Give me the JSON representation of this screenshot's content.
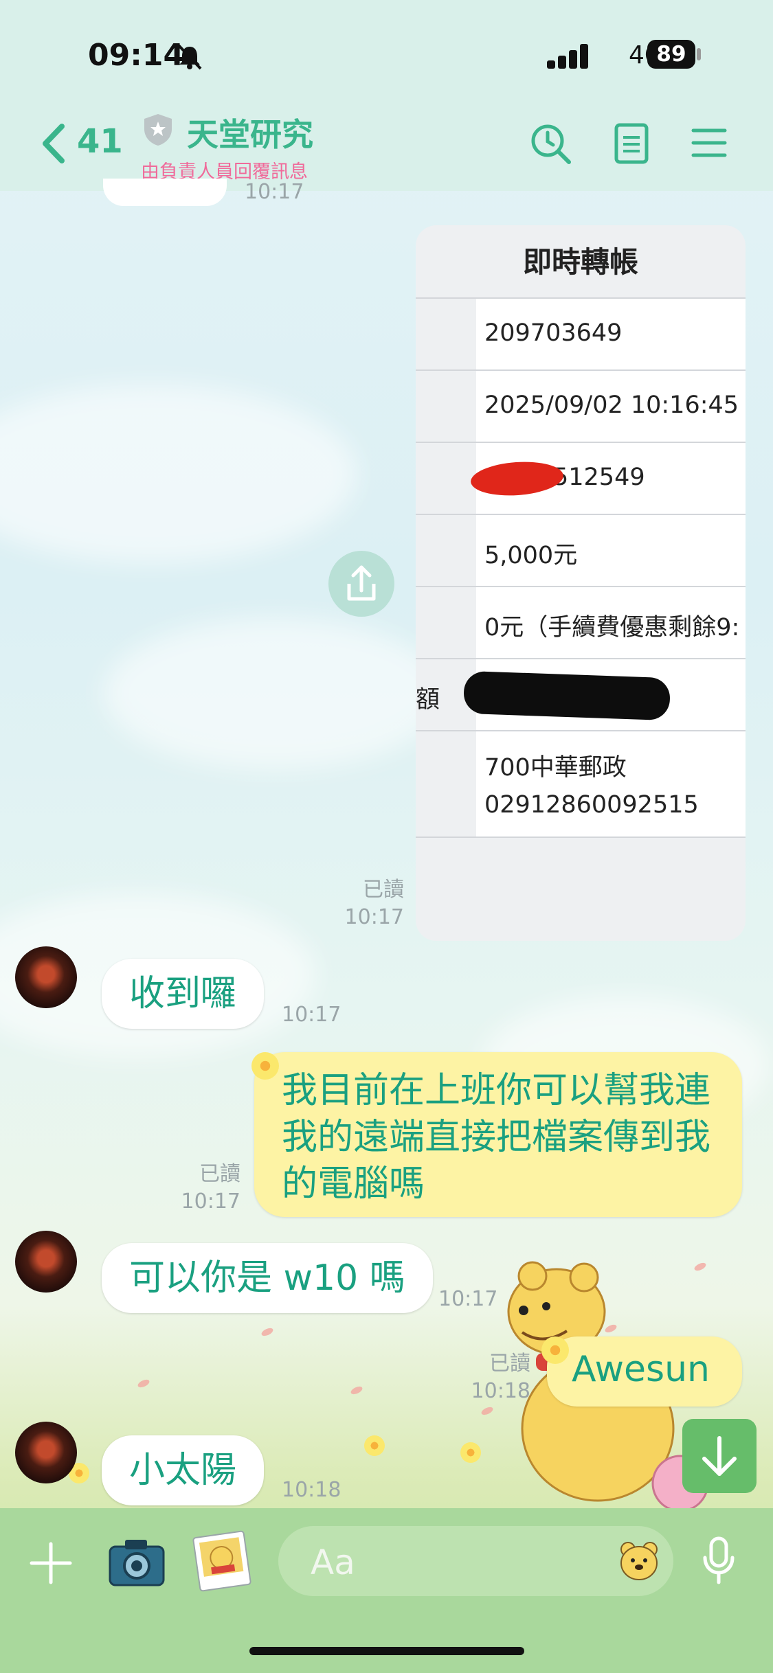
{
  "status_bar": {
    "time": "09:14",
    "network": "4G",
    "battery": "89"
  },
  "header": {
    "back_count": "41",
    "title": "天堂研究",
    "subtitle": "由負責人員回覆訊息"
  },
  "top_partial_time": "10:17",
  "transfer_card": {
    "title": "即時轉帳",
    "rows": [
      {
        "value": "209703649"
      },
      {
        "value": "2025/09/02 10:16:45"
      },
      {
        "value": "512549"
      },
      {
        "value": "5,000元"
      },
      {
        "value": "0元（手續費優惠剩餘9:"
      },
      {
        "label": "額",
        "value": ""
      },
      {
        "value": "700中華郵政\n02912860092515"
      }
    ],
    "read": "已讀",
    "time": "10:17"
  },
  "messages": [
    {
      "side": "in",
      "text": "收到囉",
      "time": "10:17"
    },
    {
      "side": "out",
      "text": "我目前在上班你可以幫我連我的遠端直接把檔案傳到我的電腦嗎",
      "read": "已讀",
      "time": "10:17"
    },
    {
      "side": "in",
      "text": "可以你是 w10 嗎",
      "time": "10:17"
    },
    {
      "side": "out",
      "text": "Awesun",
      "read": "已讀",
      "time": "10:18"
    },
    {
      "side": "in",
      "text": "小太陽",
      "time": "10:18"
    }
  ],
  "input": {
    "placeholder": "Aa"
  },
  "colors": {
    "accent": "#3ab58c",
    "outgoing_bubble": "#fdf3a4",
    "input_bar": "#a9d89c"
  }
}
